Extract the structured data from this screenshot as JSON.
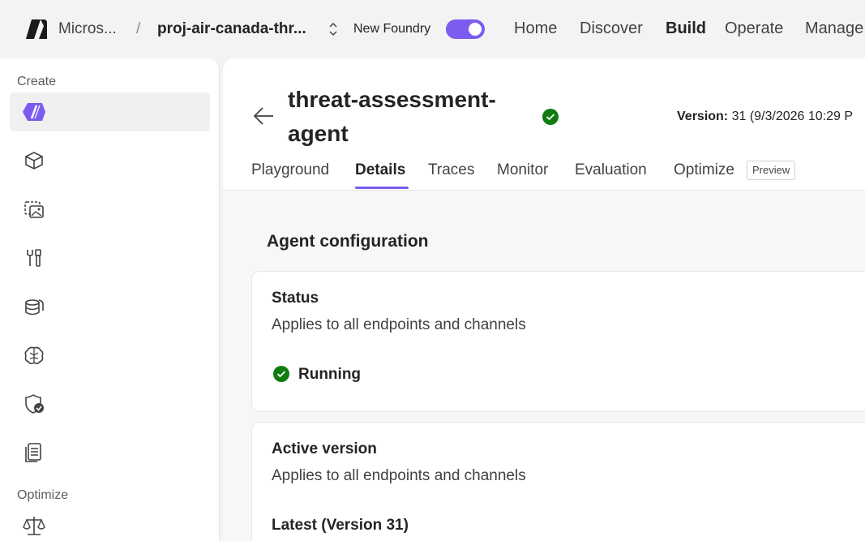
{
  "topbar": {
    "org": "Micros...",
    "separator": "/",
    "project": "proj-air-canada-thr...",
    "new_foundry_label": "New Foundry",
    "new_foundry_enabled": true,
    "nav": [
      {
        "label": "Home",
        "active": false
      },
      {
        "label": "Discover",
        "active": false
      },
      {
        "label": "Build",
        "active": true
      },
      {
        "label": "Operate",
        "active": false
      },
      {
        "label": "Manage",
        "active": false
      }
    ]
  },
  "sidebar": {
    "create_label": "Create",
    "optimize_label": "Optimize",
    "items": [
      {
        "icon": "agents-icon",
        "selected": true
      },
      {
        "icon": "models-icon",
        "selected": false
      },
      {
        "icon": "images-icon",
        "selected": false
      },
      {
        "icon": "tools-icon",
        "selected": false
      },
      {
        "icon": "data-icon",
        "selected": false
      },
      {
        "icon": "knowledge-icon",
        "selected": false
      },
      {
        "icon": "guardrails-icon",
        "selected": false
      },
      {
        "icon": "documents-icon",
        "selected": false
      },
      {
        "icon": "evaluation-scale-icon",
        "selected": false
      }
    ]
  },
  "agent": {
    "title": "threat-assessment-agent",
    "version_label": "Version:",
    "version_value": "31 (9/3/2026 10:29 P"
  },
  "tabs": [
    {
      "label": "Playground",
      "active": false
    },
    {
      "label": "Details",
      "active": true
    },
    {
      "label": "Traces",
      "active": false
    },
    {
      "label": "Monitor",
      "active": false
    },
    {
      "label": "Evaluation",
      "active": false
    },
    {
      "label": "Optimize",
      "active": false
    }
  ],
  "optimize_badge": "Preview",
  "config": {
    "section_title": "Agent configuration",
    "status_card": {
      "title": "Status",
      "subtitle": "Applies to all endpoints and channels",
      "value": "Running"
    },
    "version_card": {
      "title": "Active version",
      "subtitle": "Applies to all endpoints and channels",
      "value": "Latest (Version 31)"
    }
  },
  "colors": {
    "accent": "#7c5cf0",
    "success": "#107c10"
  }
}
